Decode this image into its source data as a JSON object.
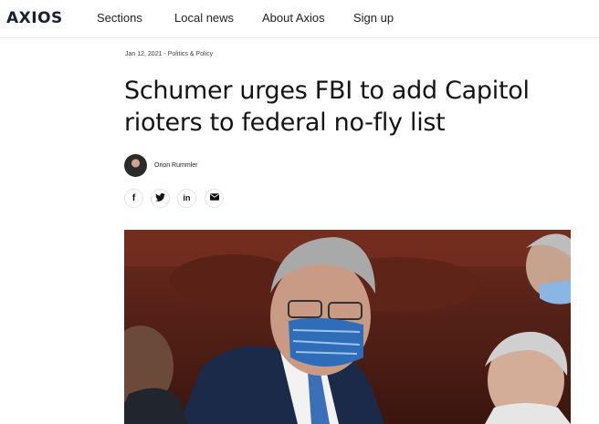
{
  "brand": {
    "logo_text": "AXIOS"
  },
  "nav": {
    "items": [
      {
        "label": "Sections"
      },
      {
        "label": "Local news"
      },
      {
        "label": "About Axios"
      },
      {
        "label": "Sign up"
      }
    ]
  },
  "article": {
    "meta": "Jan 12, 2021 - Politics & Policy",
    "headline": "Schumer urges FBI to add Capitol rioters to federal no-fly list",
    "author": "Orion Rummler"
  },
  "share": {
    "icons": [
      "facebook-icon",
      "twitter-icon",
      "linkedin-icon",
      "email-icon"
    ],
    "glyphs": [
      "f",
      "❚",
      "in",
      "✉"
    ]
  },
  "hero": {
    "icon": "hero-photo"
  }
}
